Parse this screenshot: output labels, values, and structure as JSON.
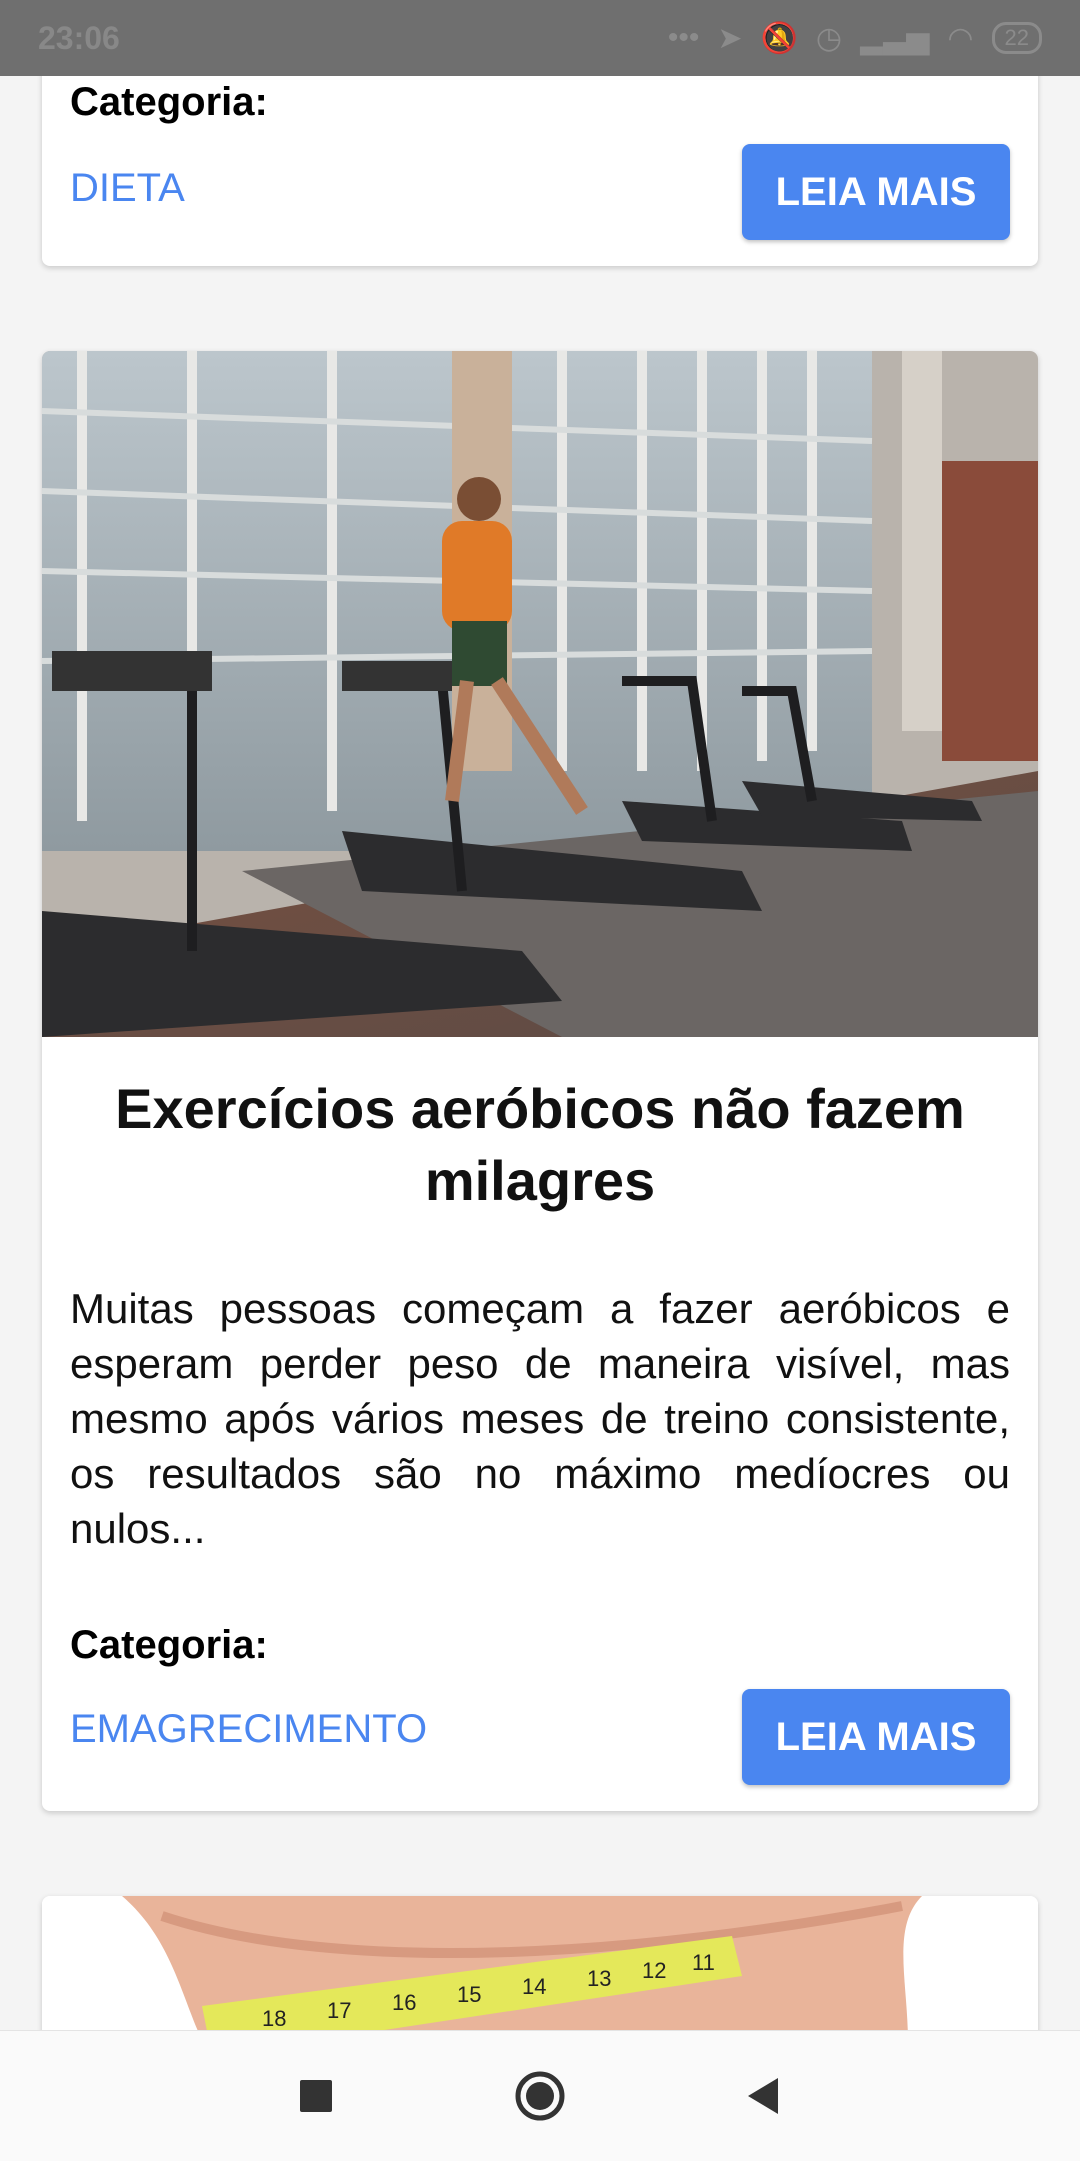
{
  "status_bar": {
    "time": "23:06",
    "battery": "22",
    "icons": [
      "more-dots-icon",
      "location-icon",
      "mute-icon",
      "alarm-icon",
      "signal-icon",
      "wifi-icon",
      "battery-icon"
    ]
  },
  "posts": [
    {
      "category_label": "Categoria:",
      "category": "DIETA",
      "button_label": "LEIA MAIS"
    },
    {
      "title": "Exercícios aeróbicos não fazem milagres",
      "excerpt": "Muitas pessoas começam a fazer aeróbicos e esperam perder peso de maneira visível, mas mesmo após vários meses de treino consistente, os resultados são no máximo medíocres ou nulos...",
      "category_label": "Categoria:",
      "category": "EMAGRECIMENTO",
      "button_label": "LEIA MAIS"
    }
  ],
  "tape_numbers": [
    "18",
    "17",
    "16",
    "15",
    "14",
    "13",
    "12",
    "11"
  ],
  "colors": {
    "accent": "#4a86f0",
    "status_bar": "#6f6f6f"
  },
  "nav_bar": [
    "recents-square-icon",
    "home-circle-icon",
    "back-triangle-icon"
  ]
}
